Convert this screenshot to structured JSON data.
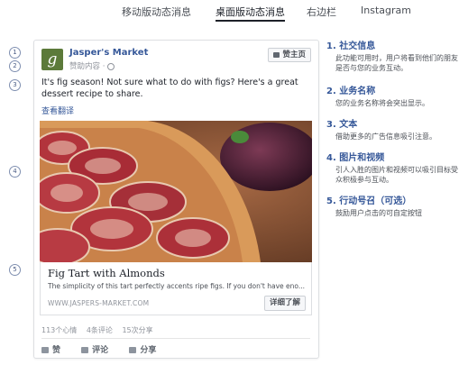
{
  "tabs": [
    {
      "label": "移动版动态消息",
      "active": false
    },
    {
      "label": "桌面版动态消息",
      "active": true
    },
    {
      "label": "右边栏",
      "active": false
    },
    {
      "label": "Instagram",
      "active": false
    }
  ],
  "markers": [
    "1",
    "2",
    "3",
    "4",
    "5"
  ],
  "post": {
    "page_name": "Jasper's Market",
    "logo_letter": "g",
    "sponsored": "赞助内容 ·",
    "like_page_button": "赞主页",
    "text": "It's fig season! Not sure what to do with figs? Here's a great dessert recipe to share.",
    "see_translation": "查看翻译",
    "link_title": "Fig Tart with Almonds",
    "link_description": "The simplicity of this tart perfectly accents ripe figs. If you don't have eno...",
    "link_url": "WWW.JASPERS-MARKET.COM",
    "cta_button": "详细了解",
    "stats": {
      "likes": "113个心情",
      "comments": "4条评论",
      "shares": "15次分享"
    },
    "actions": {
      "like": "赞",
      "comment": "评论",
      "share": "分享"
    }
  },
  "legend": [
    {
      "title": "1. 社交信息",
      "desc": "此功能可用时，用户将看到他们的朋友是否与您的业务互动。"
    },
    {
      "title": "2. 业务名称",
      "desc": "您的业务名称将会突出显示。"
    },
    {
      "title": "3. 文本",
      "desc": "借助更多的广告信息吸引注意。"
    },
    {
      "title": "4. 图片和视频",
      "desc": "引人入胜的图片和视频可以吸引目标受众积极参与互动。"
    },
    {
      "title": "5. 行动号召（可选）",
      "desc": "鼓励用户点击的可自定按钮"
    }
  ],
  "colors": {
    "link": "#365899",
    "logo": "#5c7a3a",
    "text": "#1d2129",
    "muted": "#90949c"
  }
}
